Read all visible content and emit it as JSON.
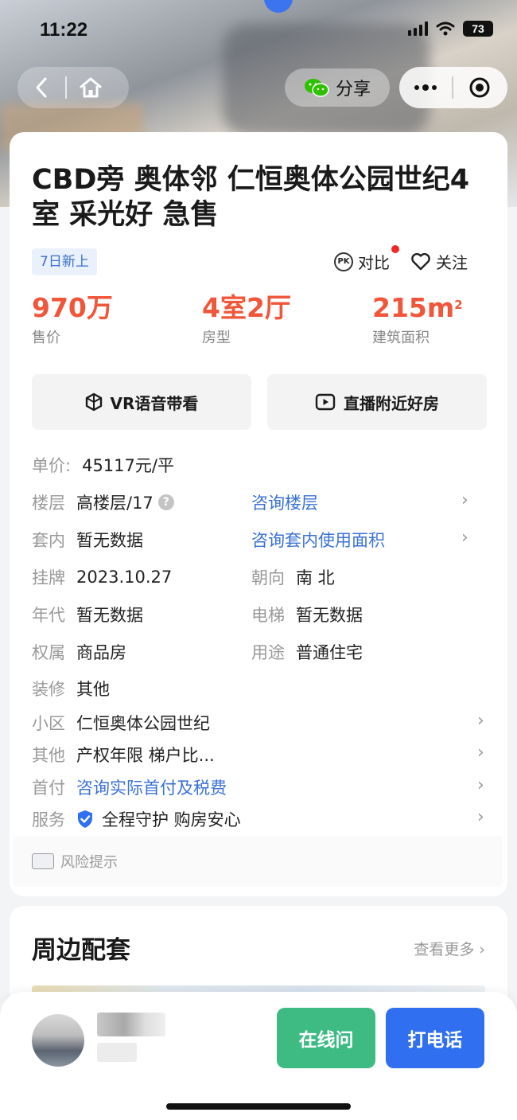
{
  "status_bar": {
    "time": "11:22",
    "battery": "73"
  },
  "nav": {
    "share_label": "分享"
  },
  "listing": {
    "title": "CBD旁 奥体邻 仁恒奥体公园世纪4室 采光好 急售",
    "badge": "7日新上",
    "compare_label": "对比",
    "follow_label": "关注",
    "stats": [
      {
        "value": "970万",
        "label": "售价"
      },
      {
        "value": "4室2厅",
        "label": "房型"
      },
      {
        "value": "215m",
        "unit_sup": "2",
        "label": "建筑面积"
      }
    ],
    "actions": [
      {
        "label": "VR语音带看",
        "icon": "vr-icon"
      },
      {
        "label": "直播附近好房",
        "icon": "live-play-icon"
      }
    ],
    "unit_price": {
      "label": "单价:",
      "value": "45117元/平"
    },
    "details": {
      "floor": {
        "label": "楼层",
        "value": "高楼层/17",
        "link": "咨询楼层"
      },
      "inner": {
        "label": "套内",
        "value": "暂无数据",
        "link": "咨询套内使用面积"
      },
      "listed": {
        "label": "挂牌",
        "value": "2023.10.27"
      },
      "orientation": {
        "label": "朝向",
        "value": "南 北"
      },
      "year": {
        "label": "年代",
        "value": "暂无数据"
      },
      "elevator": {
        "label": "电梯",
        "value": "暂无数据"
      },
      "ownership": {
        "label": "权属",
        "value": "商品房"
      },
      "usage": {
        "label": "用途",
        "value": "普通住宅"
      },
      "decoration": {
        "label": "装修",
        "value": "其他"
      },
      "community": {
        "label": "小区",
        "value": "仁恒奥体公园世纪"
      },
      "other": {
        "label": "其他",
        "value": "产权年限 梯户比..."
      },
      "down_payment": {
        "label": "首付",
        "link": "咨询实际首付及税费"
      },
      "service": {
        "label": "服务",
        "value": "全程守护 购房安心"
      }
    },
    "risk_label": "风险提示"
  },
  "surroundings": {
    "title": "周边配套",
    "more_label": "查看更多"
  },
  "bottom": {
    "chat_label": "在线问",
    "call_label": "打电话"
  },
  "colors": {
    "price": "#f0563a",
    "link": "#3a72d4",
    "chat": "#3dbb83",
    "call": "#2f6ff0"
  }
}
